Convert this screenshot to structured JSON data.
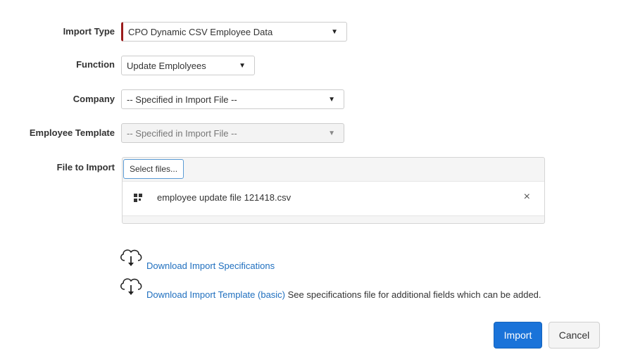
{
  "form": {
    "import_type": {
      "label": "Import Type",
      "value": "CPO Dynamic CSV Employee Data"
    },
    "function": {
      "label": "Function",
      "value": "Update Emplolyees"
    },
    "company": {
      "label": "Company",
      "value": "-- Specified in Import File --"
    },
    "employee_template": {
      "label": "Employee Template",
      "value": "-- Specified in Import File --"
    },
    "file_to_import": {
      "label": "File to Import",
      "select_button": "Select files...",
      "files": [
        {
          "name": "employee update file 121418.csv"
        }
      ],
      "remove_icon": "×"
    }
  },
  "downloads": {
    "specifications": {
      "link": "Download Import Specifications"
    },
    "template": {
      "link": "Download Import Template (basic)",
      "note": " See specifications file for additional fields which can be added."
    }
  },
  "actions": {
    "import": "Import",
    "cancel": "Cancel"
  },
  "colors": {
    "accent": "#1a73d9",
    "link": "#1f6fbf",
    "required_marker": "#9b1c1c"
  },
  "icons": {
    "dropdown": "caret-down-icon",
    "file": "file-grid-icon",
    "remove": "close-icon",
    "download": "cloud-download-icon"
  }
}
